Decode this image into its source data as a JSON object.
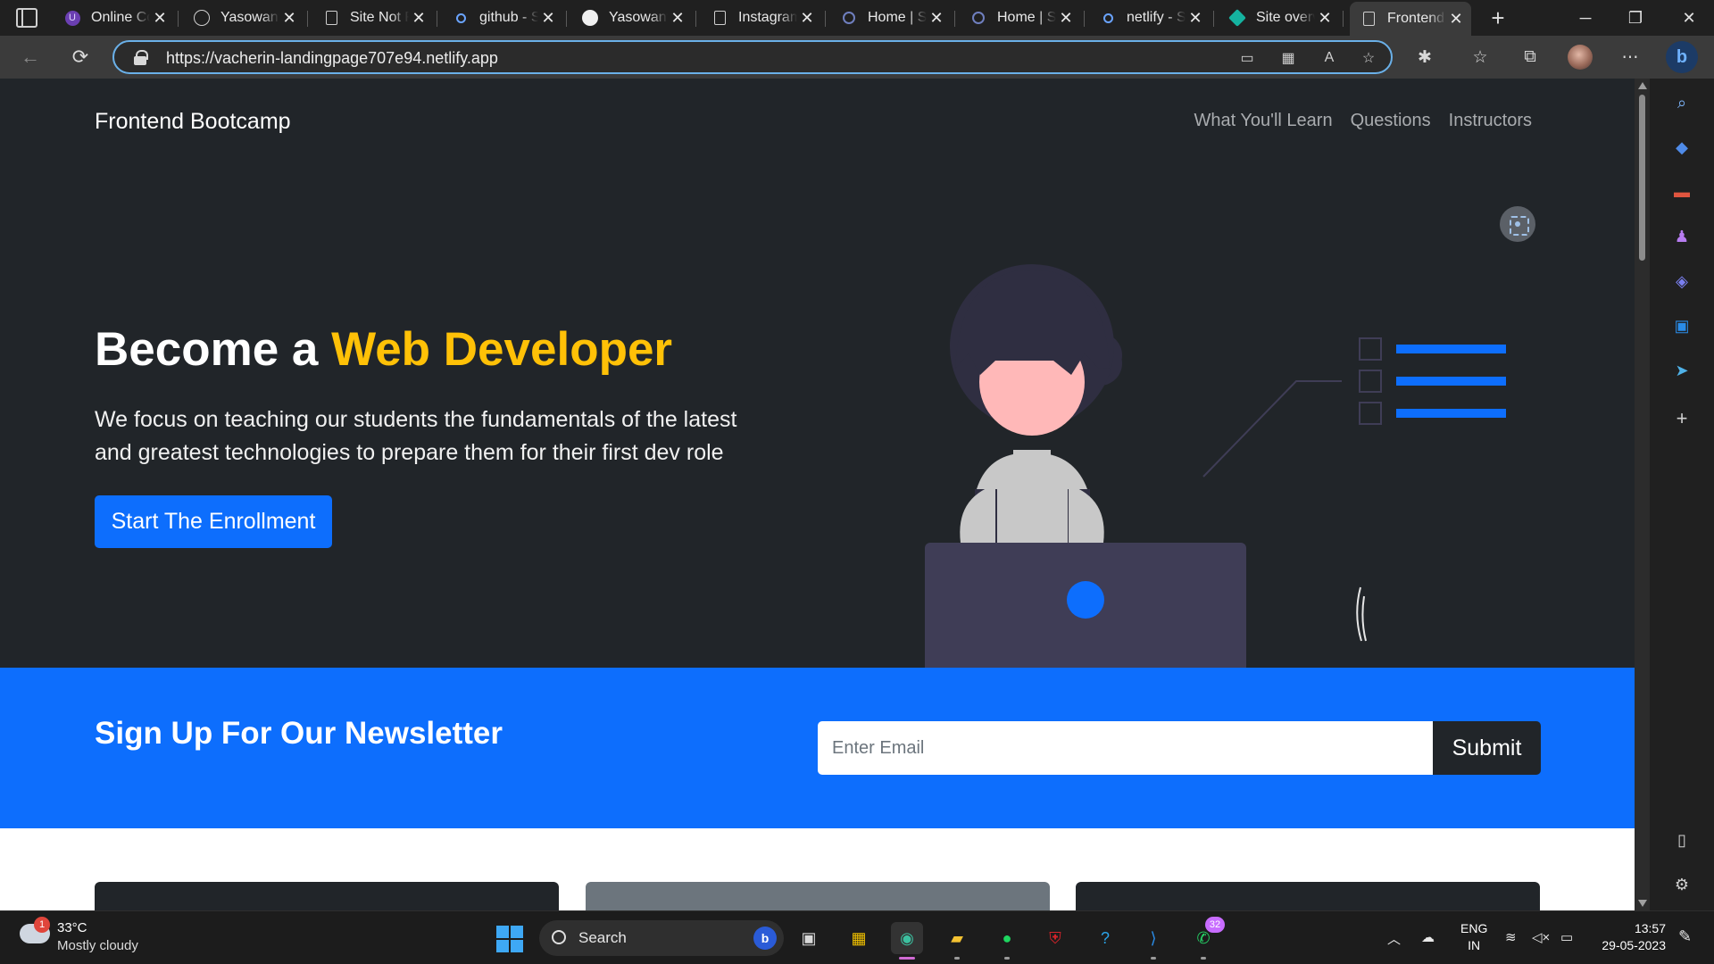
{
  "browser": {
    "tabs": [
      {
        "title": "Online Co",
        "icon": "u-icon"
      },
      {
        "title": "Yasowant",
        "icon": "react-icon"
      },
      {
        "title": "Site Not F",
        "icon": "page-icon"
      },
      {
        "title": "github - S",
        "icon": "search-icon"
      },
      {
        "title": "Yasowant",
        "icon": "github-icon"
      },
      {
        "title": "Instagram",
        "icon": "page-icon"
      },
      {
        "title": "Home | S",
        "icon": "ring-icon"
      },
      {
        "title": "Home | S",
        "icon": "ring-icon"
      },
      {
        "title": "netlify - S",
        "icon": "search-icon"
      },
      {
        "title": "Site overv",
        "icon": "netlify-icon"
      },
      {
        "title": "Frontend",
        "icon": "page-icon",
        "active": true
      }
    ],
    "address": {
      "url": "https://vacherin-landingpage707e94.netlify.app"
    },
    "accent": "#6ab0e8"
  },
  "page": {
    "brand": "Frontend Bootcamp",
    "nav": [
      "What You'll Learn",
      "Questions",
      "Instructors"
    ],
    "hero": {
      "title_plain": "Become a",
      "title_accent": "Web Developer",
      "text": "We focus on teaching our students the fundamentals of the latest and greatest technologies to prepare them for their first dev role",
      "button": "Start The Enrollment"
    },
    "newsletter": {
      "title": "Sign Up For Our Newsletter",
      "email_placeholder": "Enter Email",
      "submit": "Submit"
    },
    "colors": {
      "primary": "#0d6efd",
      "dark": "#212529",
      "accent": "#ffc107"
    }
  },
  "taskbar": {
    "weather": {
      "temp": "33°C",
      "condition": "Mostly cloudy",
      "badge": "1"
    },
    "search_label": "Search",
    "whatsapp_badge": "32",
    "lang": {
      "line1": "ENG",
      "line2": "IN"
    },
    "clock": {
      "time": "13:57",
      "date": "29-05-2023"
    }
  }
}
